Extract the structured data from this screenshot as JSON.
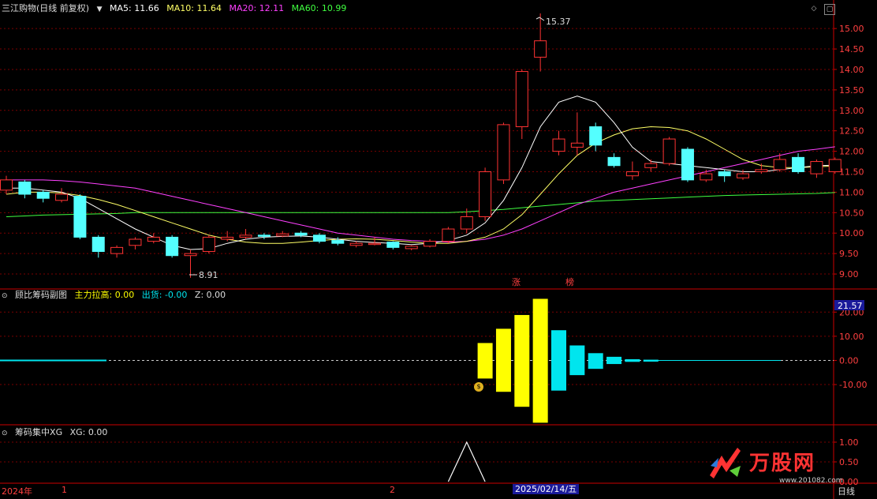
{
  "colors": {
    "up": "#ff3333",
    "down": "#54ffff",
    "ma5": "#ffffff",
    "ma10": "#ffff66",
    "ma20": "#ff40ff",
    "ma60": "#40ff40",
    "grid": "#7a0000",
    "axis": "#cc0000",
    "main_force": "#ffff00",
    "distribution": "#00e5ee"
  },
  "header": {
    "title": "三江购物(日线 前复权)",
    "ma5": "MA5: 11.66",
    "ma10": "MA10: 11.64",
    "ma20": "MA20: 12.11",
    "ma60": "MA60: 10.99"
  },
  "price_panel": {
    "y_ticks": [
      "15.00",
      "14.50",
      "14.00",
      "13.50",
      "13.00",
      "12.50",
      "12.00",
      "11.50",
      "11.00",
      "10.50",
      "10.00",
      "9.50",
      "9.00"
    ],
    "high_label": "15.37",
    "low_label": "8.91",
    "tags": [
      "涨",
      "榜"
    ],
    "candles": [
      {
        "o": 11.05,
        "c": 11.3,
        "h": 11.4,
        "l": 10.95
      },
      {
        "o": 11.25,
        "c": 10.95,
        "h": 11.3,
        "l": 10.85
      },
      {
        "o": 11.0,
        "c": 10.85,
        "h": 11.05,
        "l": 10.75
      },
      {
        "o": 10.8,
        "c": 10.95,
        "h": 11.1,
        "l": 10.75
      },
      {
        "o": 10.9,
        "c": 9.9,
        "h": 10.95,
        "l": 9.85
      },
      {
        "o": 9.9,
        "c": 9.55,
        "h": 9.95,
        "l": 9.4
      },
      {
        "o": 9.5,
        "c": 9.65,
        "h": 9.7,
        "l": 9.4
      },
      {
        "o": 9.7,
        "c": 9.85,
        "h": 9.9,
        "l": 9.6
      },
      {
        "o": 9.8,
        "c": 9.9,
        "h": 10.0,
        "l": 9.75
      },
      {
        "o": 9.9,
        "c": 9.45,
        "h": 9.95,
        "l": 9.4
      },
      {
        "o": 9.45,
        "c": 9.5,
        "h": 9.6,
        "l": 8.91
      },
      {
        "o": 9.55,
        "c": 9.9,
        "h": 9.95,
        "l": 9.5
      },
      {
        "o": 9.85,
        "c": 9.9,
        "h": 10.05,
        "l": 9.8
      },
      {
        "o": 9.9,
        "c": 9.95,
        "h": 10.1,
        "l": 9.85
      },
      {
        "o": 9.95,
        "c": 9.93,
        "h": 10.0,
        "l": 9.85
      },
      {
        "o": 9.93,
        "c": 9.98,
        "h": 10.05,
        "l": 9.9
      },
      {
        "o": 10.0,
        "c": 9.95,
        "h": 10.05,
        "l": 9.9
      },
      {
        "o": 9.95,
        "c": 9.8,
        "h": 10.0,
        "l": 9.75
      },
      {
        "o": 9.82,
        "c": 9.75,
        "h": 9.9,
        "l": 9.7
      },
      {
        "o": 9.7,
        "c": 9.75,
        "h": 9.8,
        "l": 9.65
      },
      {
        "o": 9.75,
        "c": 9.75,
        "h": 9.9,
        "l": 9.7
      },
      {
        "o": 9.78,
        "c": 9.65,
        "h": 9.8,
        "l": 9.6
      },
      {
        "o": 9.62,
        "c": 9.68,
        "h": 9.7,
        "l": 9.58
      },
      {
        "o": 9.68,
        "c": 9.8,
        "h": 9.85,
        "l": 9.65
      },
      {
        "o": 9.8,
        "c": 10.1,
        "h": 10.15,
        "l": 9.75
      },
      {
        "o": 10.1,
        "c": 10.4,
        "h": 10.6,
        "l": 10.0
      },
      {
        "o": 10.4,
        "c": 11.5,
        "h": 11.6,
        "l": 10.3
      },
      {
        "o": 11.3,
        "c": 12.65,
        "h": 12.7,
        "l": 11.2
      },
      {
        "o": 12.6,
        "c": 13.95,
        "h": 14.0,
        "l": 12.3
      },
      {
        "o": 14.3,
        "c": 14.7,
        "h": 15.37,
        "l": 13.95
      },
      {
        "o": 12.0,
        "c": 12.3,
        "h": 12.5,
        "l": 11.9
      },
      {
        "o": 12.1,
        "c": 12.2,
        "h": 12.95,
        "l": 11.9
      },
      {
        "o": 12.6,
        "c": 12.15,
        "h": 12.7,
        "l": 12.0
      },
      {
        "o": 11.85,
        "c": 11.65,
        "h": 11.95,
        "l": 11.6
      },
      {
        "o": 11.4,
        "c": 11.5,
        "h": 11.75,
        "l": 11.3
      },
      {
        "o": 11.6,
        "c": 11.7,
        "h": 11.8,
        "l": 11.5
      },
      {
        "o": 11.7,
        "c": 12.3,
        "h": 12.35,
        "l": 11.65
      },
      {
        "o": 12.05,
        "c": 11.3,
        "h": 12.1,
        "l": 11.25
      },
      {
        "o": 11.3,
        "c": 11.45,
        "h": 11.55,
        "l": 11.25
      },
      {
        "o": 11.5,
        "c": 11.4,
        "h": 11.55,
        "l": 11.25
      },
      {
        "o": 11.35,
        "c": 11.45,
        "h": 11.55,
        "l": 11.3
      },
      {
        "o": 11.5,
        "c": 11.55,
        "h": 11.7,
        "l": 11.45
      },
      {
        "o": 11.55,
        "c": 11.8,
        "h": 11.95,
        "l": 11.5
      },
      {
        "o": 11.85,
        "c": 11.5,
        "h": 11.95,
        "l": 11.45
      },
      {
        "o": 11.45,
        "c": 11.75,
        "h": 11.8,
        "l": 11.35
      },
      {
        "o": 11.5,
        "c": 11.8,
        "h": 11.85,
        "l": 11.45
      }
    ],
    "ma5": [
      11.1,
      11.1,
      11.05,
      11.0,
      10.85,
      10.6,
      10.35,
      10.1,
      9.9,
      9.7,
      9.6,
      9.62,
      9.75,
      9.85,
      9.9,
      9.92,
      9.93,
      9.9,
      9.85,
      9.8,
      9.77,
      9.75,
      9.72,
      9.75,
      9.82,
      9.95,
      10.25,
      10.8,
      11.6,
      12.6,
      13.2,
      13.35,
      13.2,
      12.7,
      12.1,
      11.75,
      11.7,
      11.65,
      11.6,
      11.55,
      11.5,
      11.5,
      11.55,
      11.6,
      11.65,
      11.66
    ],
    "ma10": [
      10.95,
      11.0,
      11.0,
      10.98,
      10.92,
      10.82,
      10.7,
      10.55,
      10.4,
      10.25,
      10.1,
      9.95,
      9.85,
      9.78,
      9.75,
      9.75,
      9.78,
      9.82,
      9.85,
      9.86,
      9.85,
      9.82,
      9.78,
      9.75,
      9.75,
      9.8,
      9.9,
      10.1,
      10.45,
      10.95,
      11.45,
      11.9,
      12.2,
      12.4,
      12.55,
      12.6,
      12.58,
      12.5,
      12.3,
      12.05,
      11.8,
      11.65,
      11.6,
      11.6,
      11.62,
      11.64
    ],
    "ma20": [
      11.3,
      11.3,
      11.3,
      11.28,
      11.25,
      11.2,
      11.15,
      11.1,
      11.0,
      10.9,
      10.8,
      10.7,
      10.6,
      10.5,
      10.4,
      10.3,
      10.2,
      10.1,
      10.0,
      9.95,
      9.9,
      9.85,
      9.82,
      9.8,
      9.78,
      9.8,
      9.85,
      9.95,
      10.1,
      10.3,
      10.5,
      10.7,
      10.85,
      11.0,
      11.1,
      11.2,
      11.3,
      11.4,
      11.5,
      11.6,
      11.7,
      11.8,
      11.9,
      12.0,
      12.05,
      12.11
    ],
    "ma60": [
      10.4,
      10.42,
      10.44,
      10.45,
      10.46,
      10.47,
      10.48,
      10.5,
      10.5,
      10.5,
      10.5,
      10.5,
      10.5,
      10.5,
      10.5,
      10.5,
      10.5,
      10.5,
      10.5,
      10.5,
      10.5,
      10.5,
      10.5,
      10.5,
      10.5,
      10.52,
      10.55,
      10.58,
      10.62,
      10.66,
      10.7,
      10.74,
      10.78,
      10.8,
      10.82,
      10.84,
      10.86,
      10.88,
      10.9,
      10.92,
      10.93,
      10.94,
      10.95,
      10.96,
      10.97,
      10.99
    ]
  },
  "sub1": {
    "title": "顾比筹码副图",
    "main_force": "主力拉高: 0.00",
    "distribution": "出货: -0.00",
    "z": "Z: 0.00",
    "current_value": "21.57",
    "y_ticks": [
      "20.00",
      "10.00",
      "0.00",
      "-10.00"
    ],
    "yellow_bars": [
      {
        "i": 26,
        "top": 7.2,
        "bot": -7.5
      },
      {
        "i": 27,
        "top": 13.1,
        "bot": -13.0
      },
      {
        "i": 28,
        "top": 18.8,
        "bot": -19.2
      },
      {
        "i": 29,
        "top": 25.5,
        "bot": -25.8
      }
    ],
    "cyan_bars": [
      {
        "i": 30,
        "top": 12.5,
        "bot": -12.5
      },
      {
        "i": 31,
        "top": 6.2,
        "bot": -6.1
      },
      {
        "i": 32,
        "top": 3.0,
        "bot": -3.5
      },
      {
        "i": 33,
        "top": 1.5,
        "bot": -1.5
      },
      {
        "i": 34,
        "top": 0.5,
        "bot": -0.6
      },
      {
        "i": 35,
        "top": 0.3,
        "bot": -0.5
      }
    ]
  },
  "sub2": {
    "title": "筹码集中XG",
    "xg": "XG: 0.00",
    "y_ticks": [
      "1.00",
      "0.50",
      "0.00"
    ],
    "signal": [
      {
        "i": 24,
        "v": 0
      },
      {
        "i": 25,
        "v": 1
      },
      {
        "i": 26,
        "v": 0
      }
    ]
  },
  "axis": {
    "labels": [
      "2024年",
      "1",
      "2"
    ],
    "date": "2025/02/14/五",
    "period": "日线"
  },
  "logo": {
    "name": "万股网",
    "site": "www.201082.com"
  }
}
